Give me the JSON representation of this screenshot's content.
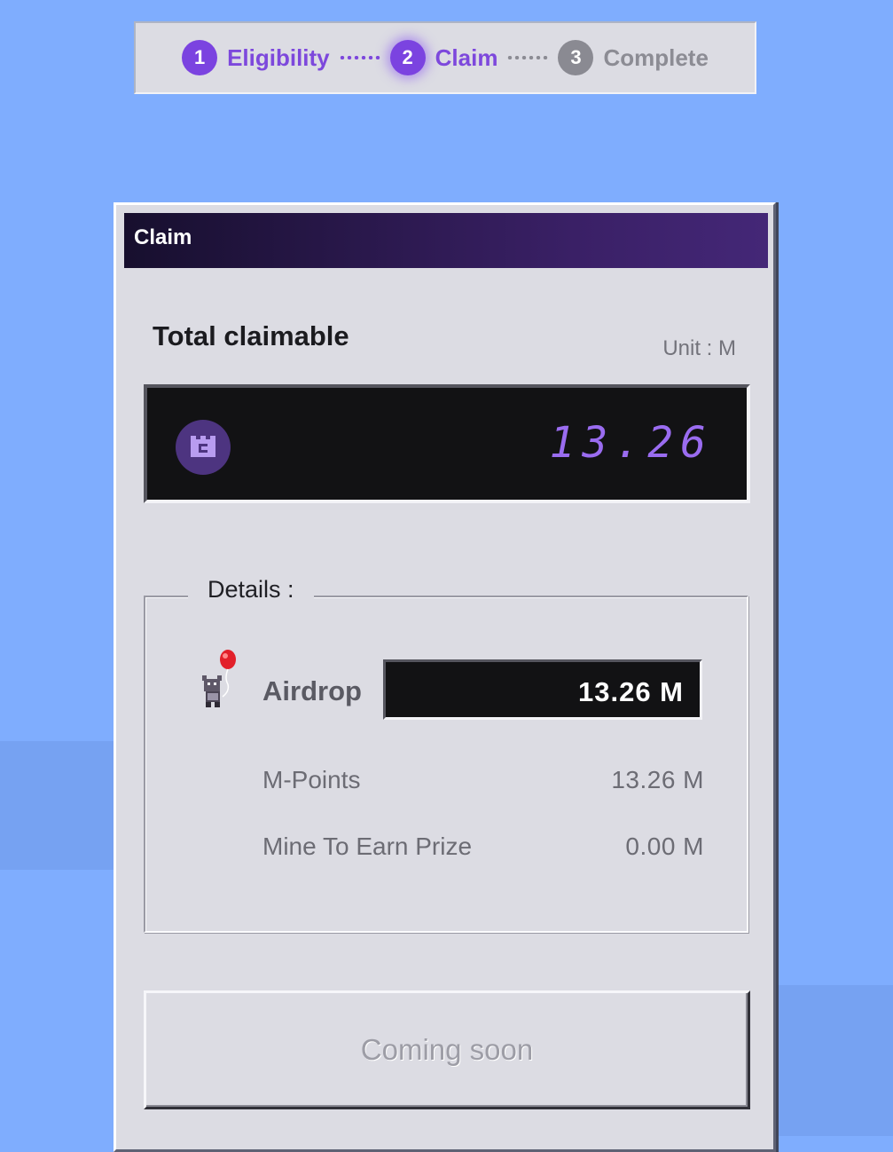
{
  "stepper": {
    "steps": [
      {
        "number": "1",
        "label": "Eligibility",
        "state": "done"
      },
      {
        "number": "2",
        "label": "Claim",
        "state": "active"
      },
      {
        "number": "3",
        "label": "Complete",
        "state": "todo"
      }
    ]
  },
  "window": {
    "title": "Claim",
    "total_label": "Total claimable",
    "unit_label": "Unit : M",
    "total_value": "13.26",
    "coin_icon": "coin-icon",
    "details": {
      "legend": "Details :",
      "airdrop_label": "Airdrop",
      "airdrop_icon": "balloon-character-icon",
      "airdrop_value": "13.26  M",
      "rows": [
        {
          "label": "M-Points",
          "value": "13.26  M"
        },
        {
          "label": "Mine To Earn Prize",
          "value": "0.00  M"
        }
      ]
    },
    "button_label": "Coming soon"
  },
  "colors": {
    "accent": "#7b43e0",
    "lcd_text": "#9a6cf0",
    "background": "#7fadfe"
  }
}
